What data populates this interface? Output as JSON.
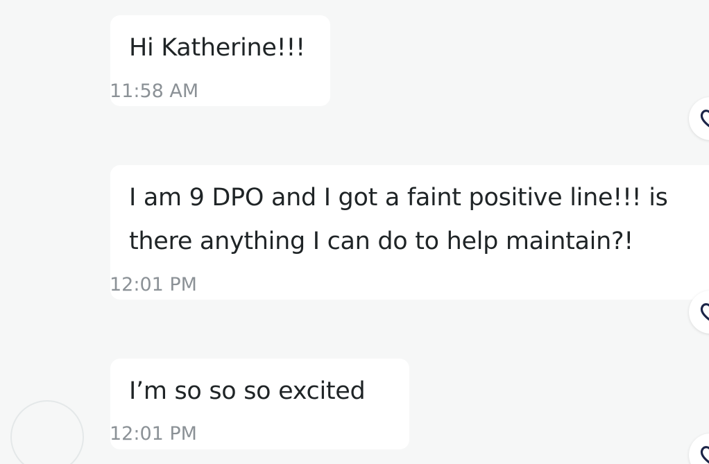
{
  "messages": [
    {
      "text_lines": [
        "Hi Katherine!!!"
      ],
      "time": "11:58 AM"
    },
    {
      "text_lines": [
        "I am 9 DPO and I got a faint positive line!!! is",
        "there anything I can do to help maintain?!"
      ],
      "time": "12:01 PM"
    },
    {
      "text_lines": [
        "I’m so so so excited"
      ],
      "time": "12:01 PM"
    }
  ],
  "icons": {
    "reaction": "heart-icon",
    "avatar": "avatar-icon"
  },
  "colors": {
    "background": "#f6f7f7",
    "bubble": "#ffffff",
    "text": "#1f2426",
    "timestamp": "#8b9196",
    "icon_stroke": "#1b2447"
  }
}
